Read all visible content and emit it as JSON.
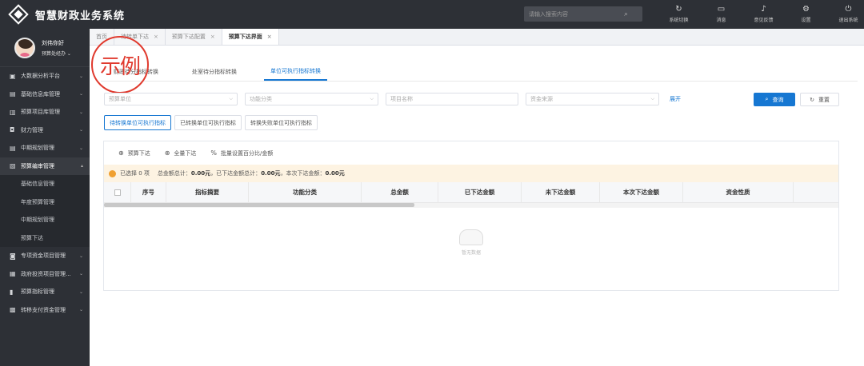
{
  "app": {
    "title": "智慧财政业务系统"
  },
  "topbar": {
    "search_placeholder": "请输入搜索内容",
    "actions": [
      {
        "icon": "refresh-icon",
        "glyph": "↻",
        "label": "系统切换"
      },
      {
        "icon": "message-icon",
        "glyph": "▭",
        "label": "消息"
      },
      {
        "icon": "bell-icon",
        "glyph": "♪",
        "label": "意见反馈"
      },
      {
        "icon": "gear-icon",
        "glyph": "⚙",
        "label": "设置"
      },
      {
        "icon": "power-icon",
        "glyph": "⏻",
        "label": "退出系统"
      }
    ]
  },
  "user": {
    "greeting": "刘伟你好",
    "role": "预算处经办 ⌄"
  },
  "sidebar": {
    "items": [
      {
        "label": "大数据分析平台",
        "icon": "▣",
        "open": false
      },
      {
        "label": "基础信息库管理",
        "icon": "▤",
        "open": false
      },
      {
        "label": "预算项目库管理",
        "icon": "▥",
        "open": false
      },
      {
        "label": "财力管理",
        "icon": "◘",
        "open": false
      },
      {
        "label": "中期规划管理",
        "icon": "▤",
        "open": false
      },
      {
        "label": "预算编审管理",
        "icon": "▧",
        "open": true
      }
    ],
    "sub_items": [
      "基础信息管理",
      "年度预算管理",
      "中期规划管理",
      "预算下达"
    ],
    "items_after": [
      {
        "label": "专项资金项目管理",
        "icon": "◙"
      },
      {
        "label": "政府投资项目管理...",
        "icon": "▦"
      },
      {
        "label": "预算指标管理",
        "icon": "▮"
      },
      {
        "label": "转移支付资金管理",
        "icon": "▩"
      }
    ]
  },
  "tabs": [
    {
      "label": "首页",
      "closable": false,
      "active": false
    },
    {
      "label": "待转单下达",
      "closable": true,
      "active": false
    },
    {
      "label": "预算下达配置",
      "closable": true,
      "active": false
    },
    {
      "label": "预算下达界面",
      "closable": true,
      "active": true
    }
  ],
  "watermark": "示例",
  "subtabs": [
    {
      "label": "财政待分指标转换",
      "active": false
    },
    {
      "label": "处室待分指标转换",
      "active": false
    },
    {
      "label": "单位可执行指标转换",
      "active": true
    }
  ],
  "filters": {
    "unit_placeholder": "预算单位",
    "func_placeholder": "功能分类",
    "project_placeholder": "项目名称",
    "fund_placeholder": "资金来源",
    "expand_label": "展开",
    "query_label": "查询",
    "reset_label": "重置"
  },
  "segments": [
    {
      "label": "待转换单位可执行指标",
      "active": true
    },
    {
      "label": "已转换单位可执行指标",
      "active": false
    },
    {
      "label": "转换失败单位可执行指标",
      "active": false
    }
  ],
  "actions": [
    {
      "icon": "plus-circle-icon",
      "glyph": "⊕",
      "label": "预算下达"
    },
    {
      "icon": "plus-circle-icon",
      "glyph": "⊕",
      "label": "全量下达"
    },
    {
      "icon": "percent-icon",
      "glyph": "%",
      "label": "批量设置百分比/金额"
    }
  ],
  "summary": {
    "selected": "已选择 0 项",
    "total_label": "总金额总计：",
    "total_value": "0.00元",
    "issued_label": "，已下达金额总计：",
    "issued_value": "0.00元",
    "current_label": "，本次下达金额：",
    "current_value": "0.00元"
  },
  "table": {
    "columns": [
      "序号",
      "指标摘要",
      "功能分类",
      "总金额",
      "已下达金额",
      "未下达金额",
      "本次下达金额",
      "资金性质"
    ],
    "rows": []
  },
  "empty_text": "暂无数据"
}
